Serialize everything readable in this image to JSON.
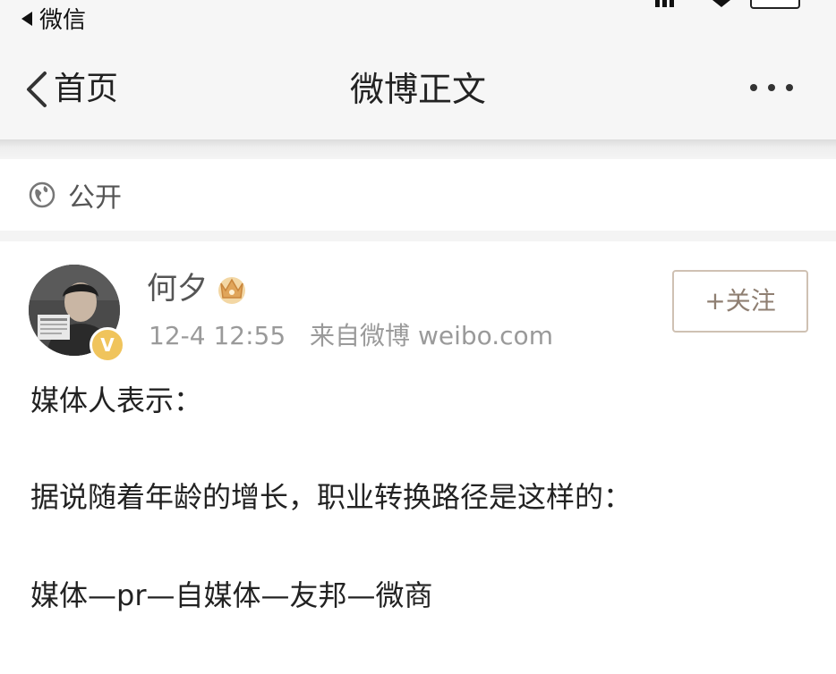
{
  "status_bar": {
    "back_app_label": "微信"
  },
  "nav": {
    "back_label": "首页",
    "title": "微博正文"
  },
  "visibility": {
    "label": "公开"
  },
  "post": {
    "author": {
      "name": "何夕",
      "verified": true
    },
    "timestamp": "12-4 12:55",
    "source": "来自微博 weibo.com",
    "follow_label": "+关注",
    "lines": [
      "媒体人表示：",
      "据说随着年龄的增长，职业转换路径是这样的：",
      "媒体—pr—自媒体—友邦—微商"
    ]
  },
  "colors": {
    "nav_background": "#f6f6f6",
    "follow_border": "#cfc1b3",
    "follow_text": "#8f7f72",
    "meta_text": "#9a9a9a",
    "verify_badge": "#f0c45c"
  },
  "icons": {
    "back_app": "triangle-left-icon",
    "nav_back": "chevron-left-icon",
    "more": "more-dots-icon",
    "visibility": "globe-icon",
    "member": "crown-icon",
    "verified": "verified-badge-icon"
  }
}
